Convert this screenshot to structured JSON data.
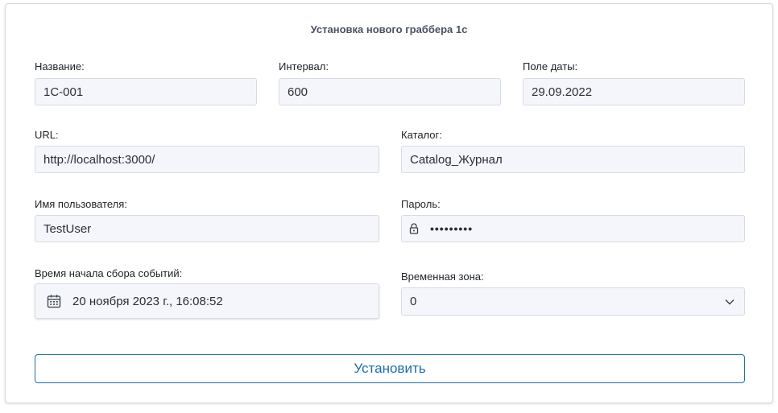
{
  "form": {
    "title": "Установка нового граббера 1с",
    "name": {
      "label": "Название:",
      "value": "1C-001"
    },
    "interval": {
      "label": "Интервал:",
      "value": "600"
    },
    "date_field": {
      "label": "Поле даты:",
      "value": "29.09.2022"
    },
    "url": {
      "label": "URL:",
      "value": "http://localhost:3000/"
    },
    "catalog": {
      "label": "Каталог:",
      "value": "Catalog_Журнал"
    },
    "username": {
      "label": "Имя пользователя:",
      "value": "TestUser"
    },
    "password": {
      "label": "Пароль:",
      "value": "•••••••••",
      "icon": "lock-icon"
    },
    "start_time": {
      "label": "Время начала сбора событий:",
      "value": "20 ноября 2023 г., 16:08:52",
      "icon": "calendar-icon"
    },
    "timezone": {
      "label": "Временная зона:",
      "value": "0",
      "icon": "chevron-down-icon"
    },
    "submit_label": "Установить"
  },
  "colors": {
    "accent": "#1c6ea8",
    "field_bg": "#f4f6fb",
    "field_border": "#d7dbe3"
  }
}
